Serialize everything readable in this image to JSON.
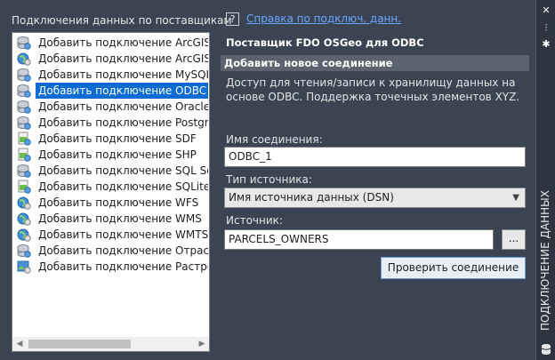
{
  "left_panel": {
    "title": "Подключения данных по поставщикам",
    "items": [
      {
        "label": "Добавить подключение ArcGIS",
        "icon": "database-icon",
        "selected": false
      },
      {
        "label": "Добавить подключение ArcGIS Onli",
        "icon": "globe-icon",
        "selected": false
      },
      {
        "label": "Добавить подключение MySQL",
        "icon": "database-icon",
        "selected": false
      },
      {
        "label": "Добавить подключение ODBC",
        "icon": "database-icon",
        "selected": true
      },
      {
        "label": "Добавить подключение Oracle",
        "icon": "database-icon",
        "selected": false
      },
      {
        "label": "Добавить подключение PostgreSQL",
        "icon": "database-icon",
        "selected": false
      },
      {
        "label": "Добавить подключение SDF",
        "icon": "file-map-icon",
        "selected": false
      },
      {
        "label": "Добавить подключение SHP",
        "icon": "file-map-icon",
        "selected": false
      },
      {
        "label": "Добавить подключение SQL Server",
        "icon": "database-icon",
        "selected": false
      },
      {
        "label": "Добавить подключение SQLite",
        "icon": "file-map-icon",
        "selected": false
      },
      {
        "label": "Добавить подключение WFS",
        "icon": "globe-icon",
        "selected": false
      },
      {
        "label": "Добавить подключение WMS",
        "icon": "globe-icon",
        "selected": false
      },
      {
        "label": "Добавить подключение WMTS",
        "icon": "globe-icon",
        "selected": false
      },
      {
        "label": "Добавить подключение Отраслева",
        "icon": "database-icon",
        "selected": false
      },
      {
        "label": "Добавить подключение Растровое",
        "icon": "raster-icon",
        "selected": false
      }
    ]
  },
  "help": {
    "icon_text": "?",
    "link": "Справка по подключ. данн."
  },
  "provider": "Поставщик FDO OSGeo для ODBC",
  "section": {
    "title": "Добавить новое соединение",
    "description": "Доступ для чтения/записи к хранилищу данных на основе ODBC. Поддержка точечных элементов XYZ."
  },
  "form": {
    "connection_name_label": "Имя соединения:",
    "connection_name_value": "ODBC_1",
    "source_type_label": "Тип источника:",
    "source_type_value": "Имя источника данных (DSN)",
    "source_label": "Источник:",
    "source_value": "PARCELS_OWNERS",
    "browse_label": "...",
    "verify_button": "Проверить соединение"
  },
  "palette": {
    "title": "ПОДКЛЮЧЕНИЕ ДАННЫХ",
    "close_glyph": "✕",
    "pin_glyph": "⫶",
    "settings_glyph": "✱"
  },
  "colors": {
    "background": "#3b4453",
    "selection": "#0a6cd4",
    "link": "#6aa8ff",
    "section_bar": "#5c6270"
  }
}
